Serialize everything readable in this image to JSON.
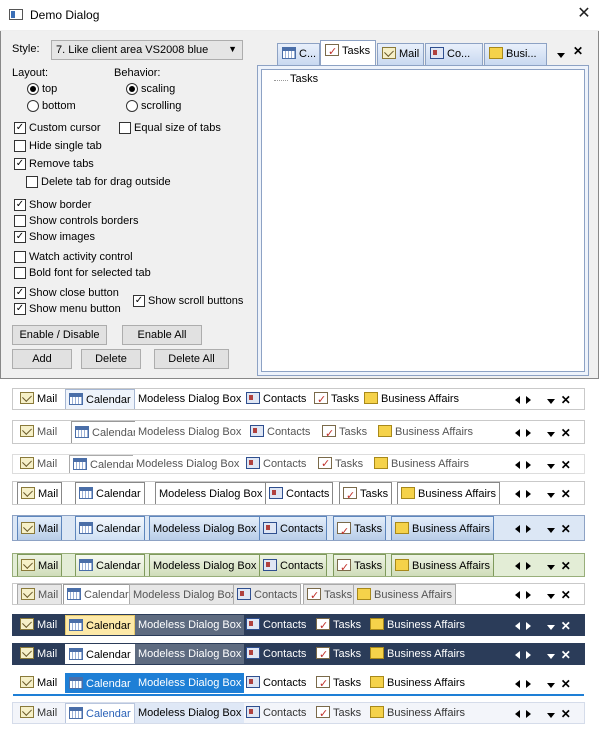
{
  "window": {
    "title": "Demo Dialog",
    "close": "✕"
  },
  "style": {
    "label": "Style:",
    "value": "7. Like client area VS2008 blue"
  },
  "layout": {
    "label": "Layout:",
    "top": "top",
    "bottom": "bottom"
  },
  "behavior": {
    "label": "Behavior:",
    "scaling": "scaling",
    "scrolling": "scrolling"
  },
  "options": {
    "custom_cursor": "Custom cursor",
    "equal_size": "Equal size of tabs",
    "hide_single": "Hide single tab",
    "remove_tabs": "Remove tabs",
    "delete_drag": "Delete tab for drag outside",
    "show_border": "Show border",
    "show_ctrl_borders": "Show controls borders",
    "show_images": "Show images",
    "watch_activity": "Watch activity control",
    "bold_font": "Bold font for selected tab",
    "show_close": "Show close button",
    "show_menu": "Show menu button",
    "show_scroll": "Show scroll buttons"
  },
  "buttons": {
    "enable_disable": "Enable / Disable",
    "enable_all": "Enable All",
    "add": "Add",
    "delete": "Delete",
    "delete_all": "Delete All"
  },
  "preview": {
    "tabs": [
      "C...",
      "Tasks",
      "Mail",
      "Co...",
      "Busi..."
    ],
    "tree_item": "Tasks"
  },
  "tab_labels": {
    "mail": "Mail",
    "calendar": "Calendar",
    "modeless": "Modeless Dialog Box",
    "contacts": "Contacts",
    "tasks": "Tasks",
    "business": "Business Affairs"
  },
  "colors": {
    "dialog_bg": "#f0f0f0",
    "vs_blue_tab": "#c8d8f0",
    "dark_strip": "#2b3c59",
    "selected_gold": "#fde9a8",
    "accent_blue": "#1e7fd6"
  }
}
